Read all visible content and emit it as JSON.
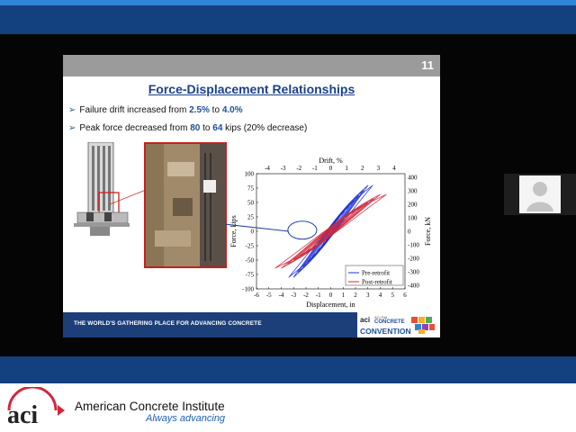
{
  "slide": {
    "number": "11",
    "title": "Force-Displacement Relationships",
    "bullets": [
      {
        "pre": "Failure drift increased from ",
        "v1": "2.5%",
        "mid": " to ",
        "v2": "4.0%",
        "post": ""
      },
      {
        "pre": "Peak force decreased from ",
        "v1": "80",
        "mid": " to ",
        "v2": "64",
        "post": " kips (20% decrease)"
      }
    ],
    "footer_text": "THE WORLD'S GATHERING PLACE FOR ADVANCING CONCRETE",
    "convention_logo": {
      "aci": "aci",
      "small": "ACI Fall",
      "concrete": "CONCRETE",
      "convention": "CONVENTION"
    }
  },
  "chart_data": {
    "type": "line",
    "xlabel": "Displacement, in",
    "ylabel": "Force, kips",
    "x2label": "Drift, %",
    "y2label": "Force, kN",
    "xlim": [
      -6,
      6
    ],
    "ylim": [
      -100,
      100
    ],
    "x_ticks": [
      "-6",
      "-5",
      "-4",
      "-3",
      "-2",
      "-1",
      "0",
      "1",
      "2",
      "3",
      "4",
      "5",
      "6"
    ],
    "y_ticks": [
      "-100",
      "-75",
      "-50",
      "-25",
      "0",
      "25",
      "50",
      "75",
      "100"
    ],
    "x2_ticks": [
      "-4",
      "-3",
      "-2",
      "-1",
      "0",
      "1",
      "2",
      "3",
      "4"
    ],
    "y2_ticks": [
      "400",
      "300",
      "200",
      "100",
      "0",
      "-100",
      "-200",
      "-300",
      "-400"
    ],
    "series": [
      {
        "name": "Pre-retrofit",
        "color": "#1f2fd6",
        "peak_force": 80,
        "max_disp": 3.4
      },
      {
        "name": "Post-retrofit",
        "color": "#d2283b",
        "peak_force": 64,
        "max_disp": 4.5
      }
    ]
  },
  "footer": {
    "org_name": "American Concrete Institute",
    "tagline": "Always advancing"
  },
  "colors": {
    "brand_blue": "#13407f",
    "accent": "#2f86d6",
    "aci_red": "#d2283b"
  }
}
